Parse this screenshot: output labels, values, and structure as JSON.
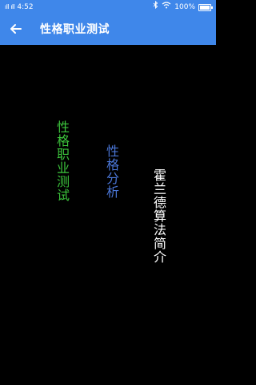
{
  "status_bar": {
    "signal": "ıll ıll",
    "time": "4:52",
    "battery_pct": "100%",
    "battery_level": 1.0,
    "bluetooth_icon": "bluetooth-icon",
    "wifi_icon": "wifi-icon"
  },
  "app_bar": {
    "title": "性格职业测试",
    "back_icon": "arrow-left-icon",
    "color": "#3f87ea"
  },
  "menu": {
    "item1": {
      "label": "性格职业测试",
      "color": "#3cc43c"
    },
    "item2": {
      "label": "性格分析",
      "color": "#4a76d6"
    },
    "item3": {
      "label": "霍兰德算法简介",
      "color": "#ffffff"
    }
  }
}
